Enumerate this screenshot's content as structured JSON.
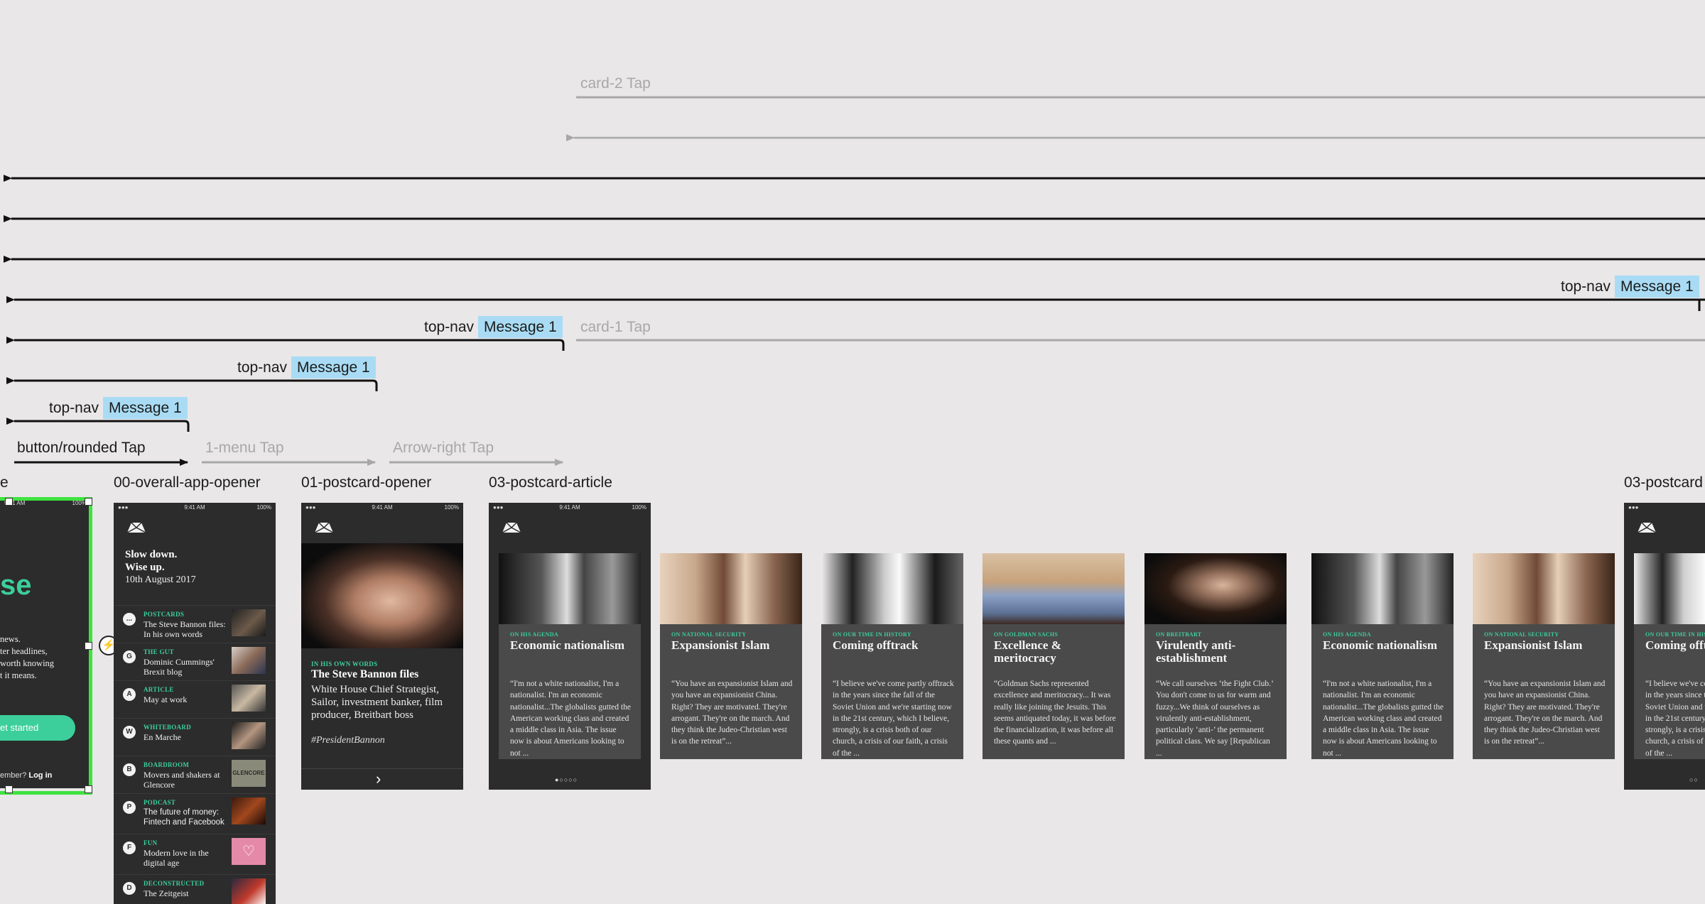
{
  "connections": {
    "card2_tap": "card-2 Tap",
    "card1_tap": "card-1 Tap",
    "top_nav": "top-nav",
    "message": "Message 1",
    "button_rounded_tap": "button/rounded Tap",
    "menu_tap": "1-menu Tap",
    "arrow_right_tap": "Arrow-right Tap"
  },
  "frames": {
    "partial_left": "e",
    "overall_app_opener": "00-overall-app-opener",
    "postcard_opener": "01-postcard-opener",
    "postcard_article": "03-postcard-article",
    "postcard_article_right": "03-postcard"
  },
  "status_bar": {
    "time": "9:41 AM",
    "battery": "100%"
  },
  "landing": {
    "big_word": "se",
    "lines": [
      "news.",
      "ter headlines,",
      "worth knowing",
      "t it means."
    ],
    "cta": "et started",
    "footer_prefix": "ember?",
    "footer_link": "Log in"
  },
  "opener": {
    "headline_1": "Slow down.",
    "headline_2": "Wise up.",
    "date": "10th August 2017",
    "items": [
      {
        "icon": "...",
        "category": "POSTCARDS",
        "text": "The Steve Bannon files: In his own words"
      },
      {
        "icon": "G",
        "category": "THE GUT",
        "text": "Dominic Cummings' Brexit blog"
      },
      {
        "icon": "A",
        "category": "ARTICLE",
        "text": "May at work"
      },
      {
        "icon": "W",
        "category": "WHITEBOARD",
        "text": "En Marche"
      },
      {
        "icon": "B",
        "category": "BOARDROOM",
        "text": "Movers and shakers at Glencore"
      },
      {
        "icon": "P",
        "category": "PODCAST",
        "text": "The future of money: Fintech and Facebook"
      },
      {
        "icon": "F",
        "category": "FUN",
        "text": "Modern love in the digital age"
      },
      {
        "icon": "D",
        "category": "DECONSTRUCTED",
        "text": "The Zeitgeist"
      }
    ],
    "thumb_text": "GLENCORE"
  },
  "postcard_opener": {
    "category": "IN HIS OWN WORDS",
    "title": "The Steve Bannon files",
    "body": "White House Chief Strategist, Sailor, investment banker, film producer, Breitbart boss",
    "hashtag": "#PresidentBannon"
  },
  "cards": [
    {
      "category": "ON HIS AGENDA",
      "title": "Economic nationalism",
      "body": "“I'm not a white nationalist, I'm a nationalist. I'm an economic nationalist...The globalists gutted the American working class and created a middle class in Asia. The issue now is about Americans looking to not ..."
    },
    {
      "category": "ON NATIONAL SECURITY",
      "title": "Expansionist Islam",
      "body": "“You have an expansionist Islam and you have an expansionist China. Right? They are motivated. They're arrogant. They're on the march. And they think the Judeo-Christian west is on the retreat”..."
    },
    {
      "category": "ON OUR TIME IN HISTORY",
      "title": "Coming offtrack",
      "body": "“I believe we've come partly offtrack in the years since the fall of the Soviet Union and we're starting now in the 21st century, which I believe, strongly, is a crisis both of our church, a crisis of our faith, a crisis of the ..."
    },
    {
      "category": "ON GOLDMAN SACHS",
      "title": "Excellence & meritocracy",
      "body": "“Goldman Sachs represented excellence and meritocracy... It was really like joining the Jesuits. This seems antiquated today, it was before the financialization, it was before all these quants and ..."
    },
    {
      "category": "ON BREITBART",
      "title": "Virulently anti-establishment",
      "body": "“We call ourselves ‘the Fight Club.’ You don't come to us for warm and fuzzy...We think of ourselves as virulently anti-establishment, particularly ‘anti-’ the permanent political class. We say [Republican ..."
    },
    {
      "category": "ON HIS AGENDA",
      "title": "Economic nationalism",
      "body": "“I'm not a white nationalist, I'm a nationalist. I'm an economic nationalist...The globalists gutted the American working class and created a middle class in Asia. The issue now is about Americans looking to not ..."
    },
    {
      "category": "ON NATIONAL SECURITY",
      "title": "Expansionist Islam",
      "body": "“You have an expansionist Islam and you have an expansionist China. Right? They are motivated. They're arrogant. They're on the march. And they think the Judeo-Christian west is on the retreat”..."
    },
    {
      "category": "ON OUR TIME IN HISTORY",
      "title": "Coming offtrack",
      "body": "“I believe we've come partly offtrack in the years since the fall of the Soviet Union and we're starting now in the 21st century, which I believe, strongly, is a crisis both of our church, a crisis of our faith, a crisis of the ..."
    }
  ],
  "colors": {
    "canvas": "#e9e7e8",
    "phone": "#2c2c2c",
    "card": "#4a4a4a",
    "accent": "#3ccf9c",
    "message_chip": "#a9dcf4",
    "selection": "#3ee33e"
  }
}
